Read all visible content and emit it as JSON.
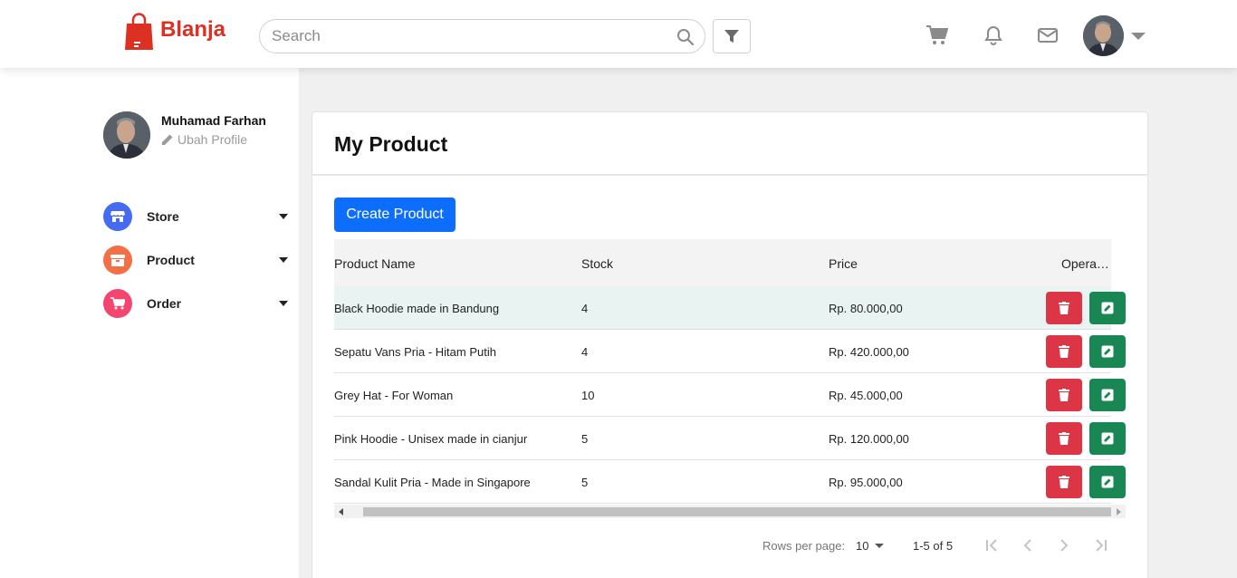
{
  "brand": {
    "name": "Blanja",
    "color": "#db3022"
  },
  "search": {
    "placeholder": "Search",
    "value": ""
  },
  "header_icons": [
    "search-icon",
    "filter-icon",
    "cart-icon",
    "bell-icon",
    "mail-icon",
    "chevron-down-icon"
  ],
  "profile": {
    "name": "Muhamad Farhan",
    "edit_label": "Ubah Profile"
  },
  "sidebar": {
    "items": [
      {
        "label": "Store",
        "icon": "store-icon",
        "color": "#456bf3"
      },
      {
        "label": "Product",
        "icon": "package-icon",
        "color": "#f36f45"
      },
      {
        "label": "Order",
        "icon": "cart-icon",
        "color": "#f3456f"
      }
    ]
  },
  "main": {
    "title": "My Product",
    "create_button": "Create Product",
    "table": {
      "columns": [
        "Product Name",
        "Stock",
        "Price",
        "Opera…"
      ],
      "rows": [
        {
          "name": "Black Hoodie made in Bandung",
          "stock": "4",
          "price": "Rp. 80.000,00"
        },
        {
          "name": "Sepatu Vans Pria - Hitam Putih",
          "stock": "4",
          "price": "Rp. 420.000,00"
        },
        {
          "name": "Grey Hat - For Woman",
          "stock": "10",
          "price": "Rp. 45.000,00"
        },
        {
          "name": "Pink Hoodie - Unisex made in cianjur",
          "stock": "5",
          "price": "Rp. 120.000,00"
        },
        {
          "name": "Sandal Kulit Pria - Made in Singapore",
          "stock": "5",
          "price": "Rp. 95.000,00"
        }
      ]
    },
    "pagination": {
      "rows_per_page_label": "Rows per page:",
      "rows_per_page": "10",
      "range": "1-5 of 5"
    }
  },
  "colors": {
    "primary": "#0d6efd",
    "danger": "#dc3545",
    "success": "#198754",
    "highlight_row": "#e8f3f2"
  }
}
